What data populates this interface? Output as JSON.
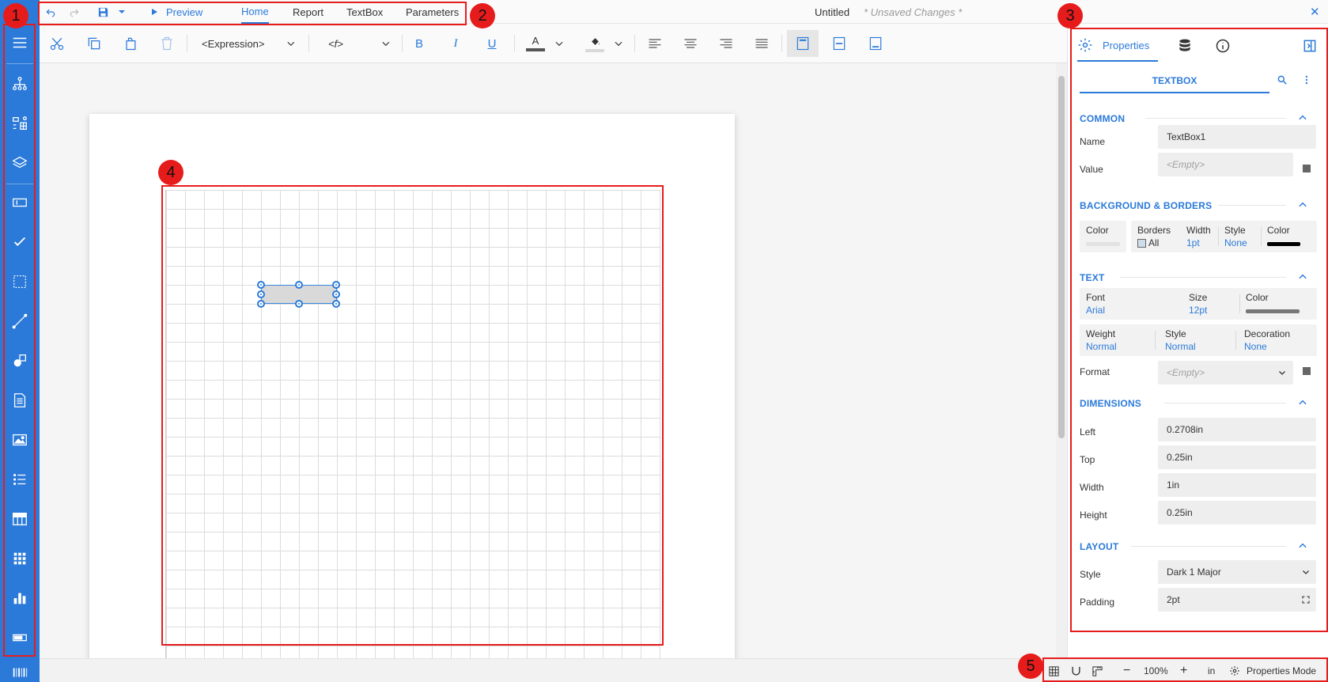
{
  "window": {
    "title": "Untitled",
    "unsaved_note": "* Unsaved Changes *",
    "close_glyph": "✕"
  },
  "topbar": {
    "preview_label": "Preview",
    "tabs": [
      {
        "label": "Home",
        "active": true
      },
      {
        "label": "Report",
        "active": false
      },
      {
        "label": "TextBox",
        "active": false
      },
      {
        "label": "Parameters",
        "active": false
      }
    ]
  },
  "toolbar": {
    "expression_value": "<Expression>",
    "function_value": "<f>",
    "bold_label": "B",
    "italic_label": "I",
    "underline_label": "U",
    "font_color_label": "A"
  },
  "sidebar": {
    "items": [
      "menu-icon",
      "report-explorer-icon",
      "group-editor-icon",
      "layers-icon",
      "textbox-icon",
      "checkbox-icon",
      "container-icon",
      "line-icon",
      "shape-icon",
      "richtext-icon",
      "image-icon",
      "list-icon",
      "table-icon",
      "tablix-icon",
      "chart-icon",
      "bullet-icon",
      "barcode-icon"
    ]
  },
  "statusbar": {
    "zoom": "100%",
    "minus_glyph": "−",
    "plus_glyph": "+",
    "unit": "in",
    "mode_label": "Properties Mode"
  },
  "panel": {
    "tabs": {
      "properties_label": "Properties"
    },
    "object_type": "TEXTBOX",
    "sections": {
      "common": {
        "title": "COMMON",
        "name_label": "Name",
        "name_value": "TextBox1",
        "value_label": "Value",
        "value_placeholder": "<Empty>"
      },
      "background": {
        "title": "BACKGROUND & BORDERS",
        "color_label": "Color",
        "borders_label": "Borders",
        "borders_value": "All",
        "width_label": "Width",
        "width_value": "1pt",
        "style_label": "Style",
        "style_value": "None",
        "border_color_label": "Color"
      },
      "text": {
        "title": "TEXT",
        "font_label": "Font",
        "font_value": "Arial",
        "size_label": "Size",
        "size_value": "12pt",
        "color_label": "Color",
        "weight_label": "Weight",
        "weight_value": "Normal",
        "style_label": "Style",
        "style_value": "Normal",
        "decoration_label": "Decoration",
        "decoration_value": "None",
        "format_label": "Format",
        "format_placeholder": "<Empty>"
      },
      "dimensions": {
        "title": "DIMENSIONS",
        "left_label": "Left",
        "left_value": "0.2708in",
        "top_label": "Top",
        "top_value": "0.25in",
        "width_label": "Width",
        "width_value": "1in",
        "height_label": "Height",
        "height_value": "0.25in"
      },
      "layout": {
        "title": "LAYOUT",
        "style_label": "Style",
        "style_value": "Dark 1 Major",
        "padding_label": "Padding",
        "padding_value": "2pt"
      }
    }
  },
  "annotations": [
    "1",
    "2",
    "3",
    "4",
    "5"
  ],
  "colors": {
    "accent": "#2b7ad9",
    "annotation": "#e61c1c"
  }
}
